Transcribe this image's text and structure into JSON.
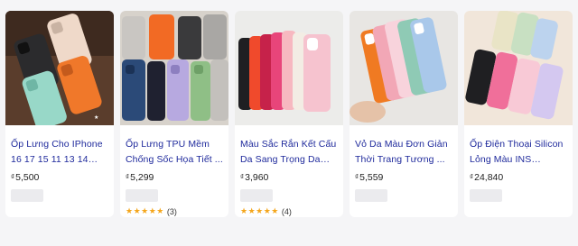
{
  "products": [
    {
      "title": "Ốp Lưng Cho IPhone 16 17 15 11 13 14 12...",
      "currency": "₫",
      "price": "5,500",
      "rating_count": null,
      "stars": null
    },
    {
      "title": "Ốp Lưng TPU Mềm Chống Sốc Họa Tiết ...",
      "currency": "₫",
      "price": "5,299",
      "rating_count": "(3)",
      "stars": "★★★★★"
    },
    {
      "title": "Màu Sắc Rắn Kết Cấu Da Sang Trọng Da C...",
      "currency": "₫",
      "price": "3,960",
      "rating_count": "(4)",
      "stars": "★★★★★"
    },
    {
      "title": "Vỏ Da Màu Đơn Giản Thời Trang Tương ...",
      "currency": "₫",
      "price": "5,559",
      "rating_count": null,
      "stars": null
    },
    {
      "title": "Ốp Điện Thoại Silicon Lỏng Màu INS Macar...",
      "currency": "₫",
      "price": "24,840",
      "rating_count": null,
      "stars": null
    }
  ],
  "colors": {
    "title_text": "#1f2a9c",
    "star": "#f4a61c",
    "page_bg": "#f5f5f7"
  }
}
